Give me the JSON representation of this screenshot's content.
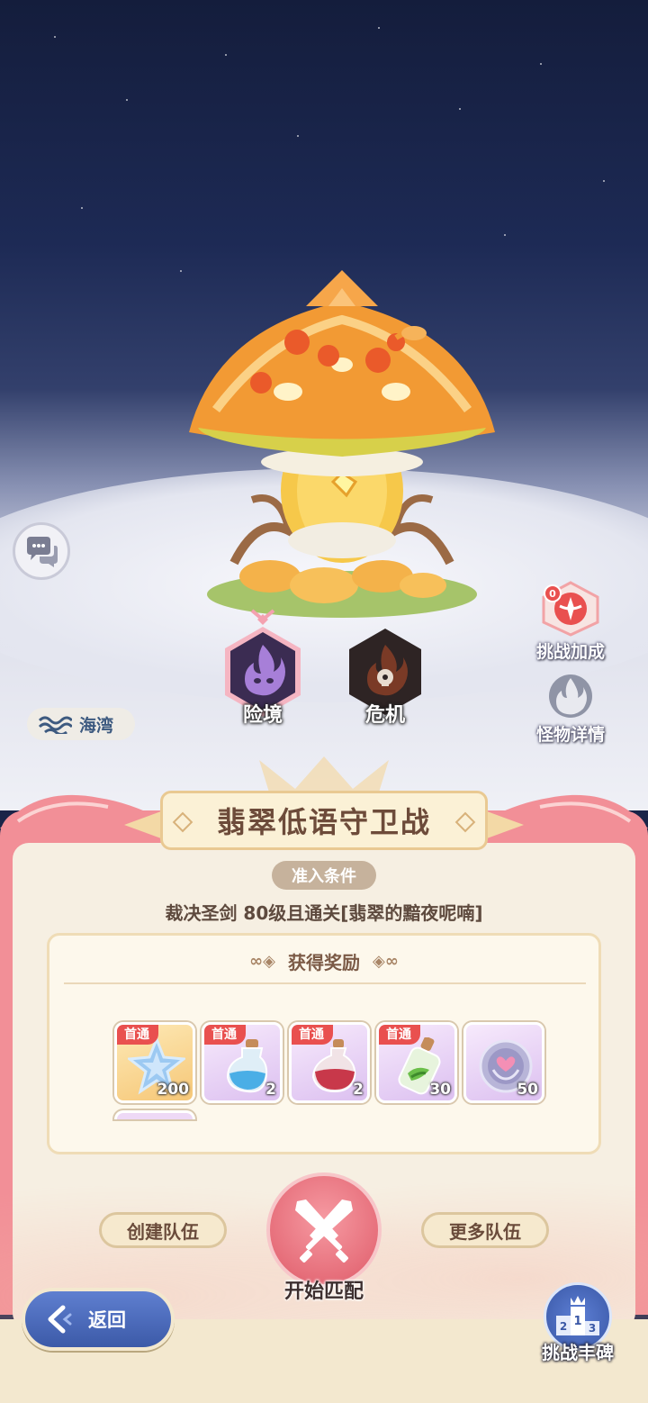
{
  "scene": {
    "region_tag": "海湾",
    "side_buttons": {
      "challenge_bonus": {
        "label": "挑战加成",
        "badge_count": "0"
      },
      "monster_details": {
        "label": "怪物详情"
      }
    },
    "difficulties": [
      {
        "label": "险境",
        "selected": true,
        "icon": "purple-flame-icon"
      },
      {
        "label": "危机",
        "selected": false,
        "icon": "dark-flame-lock-icon"
      }
    ]
  },
  "panel": {
    "title": "翡翠低语守卫战",
    "requirements_tag": "准入条件",
    "requirements_text": "裁决圣剑 80级且通关[翡翠的黯夜呢喃]",
    "rewards_header": "获得奖励",
    "rewards": [
      {
        "badge": "首通",
        "qty": "200",
        "rarity": "gold",
        "icon": "blue-crystal-star-icon"
      },
      {
        "badge": "首通",
        "qty": "2",
        "rarity": "purple",
        "icon": "blue-potion-icon"
      },
      {
        "badge": "首通",
        "qty": "2",
        "rarity": "purple",
        "icon": "red-potion-icon"
      },
      {
        "badge": "首通",
        "qty": "30",
        "rarity": "purple",
        "icon": "green-potion-icon"
      },
      {
        "badge": "",
        "qty": "50",
        "rarity": "purple",
        "icon": "heart-coin-icon"
      }
    ],
    "create_team_label": "创建队伍",
    "more_teams_label": "更多队伍",
    "start_match_label": "开始匹配"
  },
  "footer": {
    "back_label": "返回",
    "trophy_label": "挑战丰碑"
  },
  "colors": {
    "panel_frame": "#f28f97",
    "panel_bg": "#f6efe2",
    "badge_red": "#e9504f",
    "back_blue": "#4a6bbd"
  }
}
